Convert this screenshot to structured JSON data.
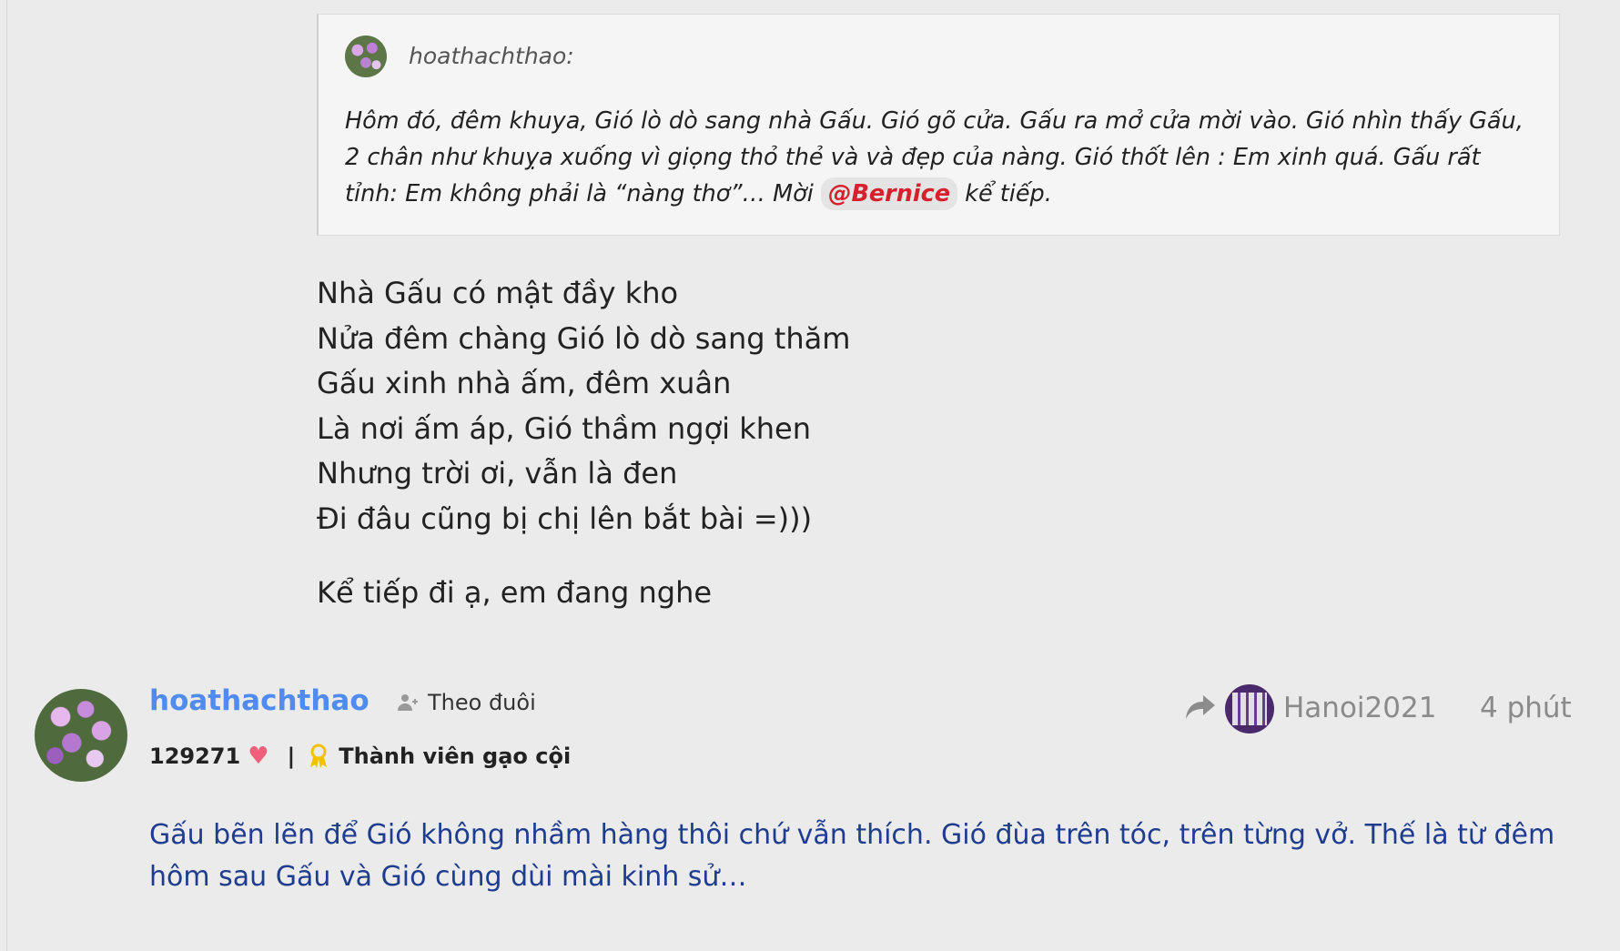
{
  "quote": {
    "author": "hoathachthao:",
    "text_before": "Hôm đó, đêm khuya, Gió lò dò sang nhà Gấu. Gió gõ cửa. Gấu ra mở cửa mời vào. Gió nhìn thấy Gấu, 2 chân như khuỵa xuống vì giọng thỏ thẻ và và đẹp của nàng. Gió thốt lên : Em xinh quá. Gấu rất tỉnh: Em không phải là “nàng thơ”… Mời ",
    "mention": "@Bernice",
    "text_after": " kể tiếp."
  },
  "poem": [
    "Nhà Gấu có mật đầy kho",
    "Nửa đêm chàng Gió lò dò sang thăm",
    "Gấu xinh nhà ấm, đêm xuân",
    "Là nơi ấm áp, Gió thầm ngợi khen",
    "Nhưng trời ơi, vẫn là đen",
    "Đi đâu cũng bị chị lên bắt bài =)))"
  ],
  "followup": "Kể tiếp đi ạ, em đang nghe",
  "comment": {
    "username": "hoathachthao",
    "follow_label": "Theo đuôi",
    "count": "129271",
    "rank": "Thành viên gạo cội",
    "reply_to": "Hanoi2021",
    "time": "4 phút",
    "text": "Gấu bẽn lẽn để Gió không nhầm hàng thôi chứ vẫn thích. Gió đùa trên tóc, trên từng vở. Thế là từ đêm hôm sau Gấu và Gió cùng dùi mài kinh sử…"
  },
  "colors": {
    "background": "#ebebeb",
    "username": "#4f8bf0",
    "mention": "#d6202e",
    "comment_text": "#1f3d8f",
    "heart": "#f0607a",
    "medal": "#f2c200"
  }
}
